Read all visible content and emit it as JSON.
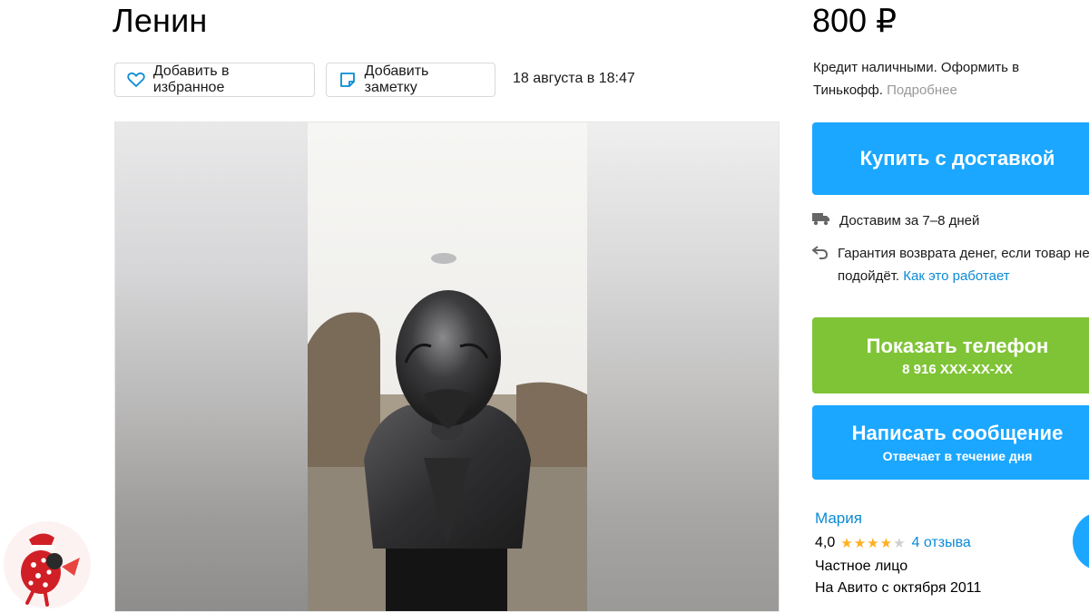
{
  "listing": {
    "title": "Ленин",
    "favorite_label": "Добавить в избранное",
    "note_label": "Добавить заметку",
    "posted_date": "18 августа в 18:47"
  },
  "sidebar": {
    "price": "800 ₽",
    "credit_text": "Кредит наличными. Оформить в Тинькофф.",
    "credit_more": "Подробнее",
    "buy_label": "Купить с доставкой",
    "delivery_text": "Доставим за 7–8 дней",
    "guarantee_text": "Гарантия возврата денег, если товар не подойдёт.",
    "guarantee_link": "Как это работает",
    "phone_label": "Показать телефон",
    "phone_number": "8 916 XXX-XX-XX",
    "message_label": "Написать сообщение",
    "message_sub": "Отвечает в течение дня"
  },
  "seller": {
    "name": "Мария",
    "rating": "4,0",
    "stars_filled": 4,
    "stars_total": 5,
    "reviews": "4 отзыва",
    "type": "Частное лицо",
    "since": "На Авито с октября 2011"
  },
  "colors": {
    "blue": "#1ba7ff",
    "green": "#7fc436",
    "link": "#0a8bd5",
    "star": "#ffb021"
  },
  "icons": [
    "heart-icon",
    "note-icon",
    "truck-icon",
    "return-icon",
    "star-icon"
  ]
}
